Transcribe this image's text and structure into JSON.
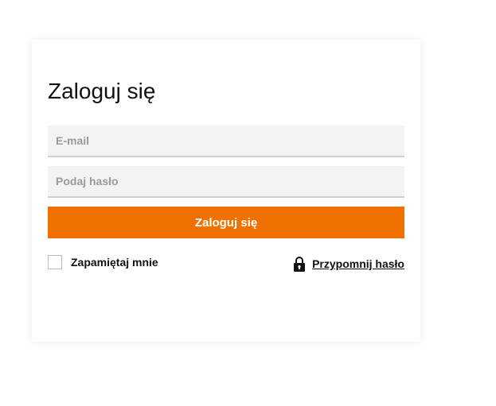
{
  "login": {
    "title": "Zaloguj się",
    "email_placeholder": "E-mail",
    "password_placeholder": "Podaj hasło",
    "submit_label": "Zaloguj się",
    "remember_label": "Zapamiętaj mnie",
    "remember_checked": false,
    "forgot_label": "Przypomnij hasło",
    "forgot_icon": "lock-icon"
  },
  "colors": {
    "accent": "#f07000",
    "input_bg": "#f3f3f3",
    "input_border": "#cfcfcf"
  }
}
